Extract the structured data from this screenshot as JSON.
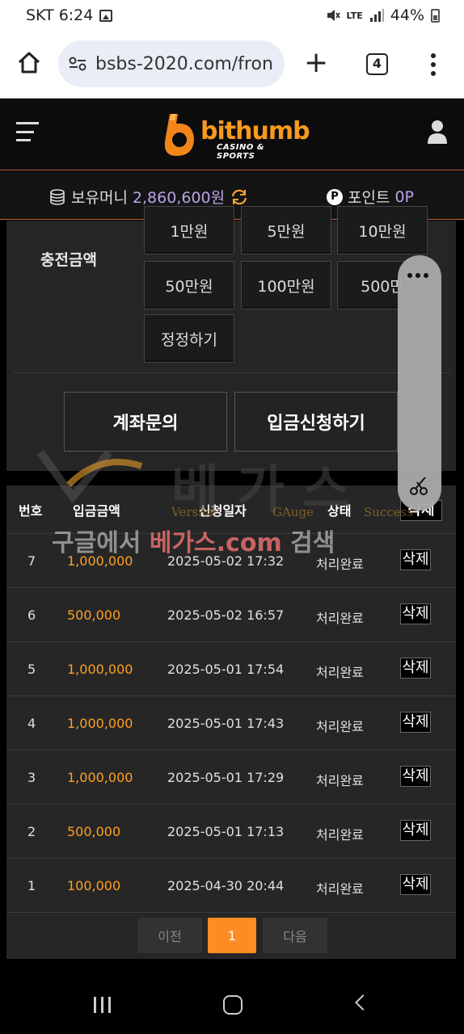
{
  "status": {
    "carrier_time": "SKT 6:24",
    "network": "LTE",
    "battery": "44%"
  },
  "browser": {
    "url": "bsbs-2020.com/fron",
    "tab_count": "4"
  },
  "site": {
    "logo_name": "bithumb",
    "logo_sub": "CASINO & SPORTS"
  },
  "balance": {
    "money_label": "보유머니",
    "money_value": "2,860,600원",
    "point_label": "포인트",
    "point_value": "0P"
  },
  "charge": {
    "label": "충전금액",
    "amounts": [
      "1만원",
      "5만원",
      "10만원",
      "50만원",
      "100만원",
      "500만"
    ],
    "reset": "정정하기",
    "account_inquiry": "계좌문의",
    "deposit_request": "입금신청하기"
  },
  "table": {
    "headers": [
      "번호",
      "입금금액",
      "신청일자",
      "상태"
    ],
    "header_delete": "삭제",
    "rows": [
      {
        "no": "7",
        "amount": "1,000,000",
        "date": "2025-05-02 17:32",
        "status": "처리완료",
        "del": "삭제"
      },
      {
        "no": "6",
        "amount": "500,000",
        "date": "2025-05-02 16:57",
        "status": "처리완료",
        "del": "삭제"
      },
      {
        "no": "5",
        "amount": "1,000,000",
        "date": "2025-05-01 17:54",
        "status": "처리완료",
        "del": "삭제"
      },
      {
        "no": "4",
        "amount": "1,000,000",
        "date": "2025-05-01 17:43",
        "status": "처리완료",
        "del": "삭제"
      },
      {
        "no": "3",
        "amount": "1,000,000",
        "date": "2025-05-01 17:29",
        "status": "처리완료",
        "del": "삭제"
      },
      {
        "no": "2",
        "amount": "500,000",
        "date": "2025-05-01 17:13",
        "status": "처리완료",
        "del": "삭제"
      },
      {
        "no": "1",
        "amount": "100,000",
        "date": "2025-04-30 20:44",
        "status": "처리완료",
        "del": "삭제"
      }
    ]
  },
  "pager": {
    "prev": "이전",
    "current": "1",
    "next": "다음"
  },
  "watermark": {
    "big": "베가스",
    "subs": [
      "Version",
      "GAuge",
      "Success"
    ],
    "line_prefix": "구글에서 ",
    "line_highlight": "베가스.com",
    "line_suffix": " 검색"
  },
  "colors": {
    "accent": "#ff8c23",
    "amount": "#ffa023",
    "money": "#b9a3e6",
    "divider": "#c06a3a"
  }
}
